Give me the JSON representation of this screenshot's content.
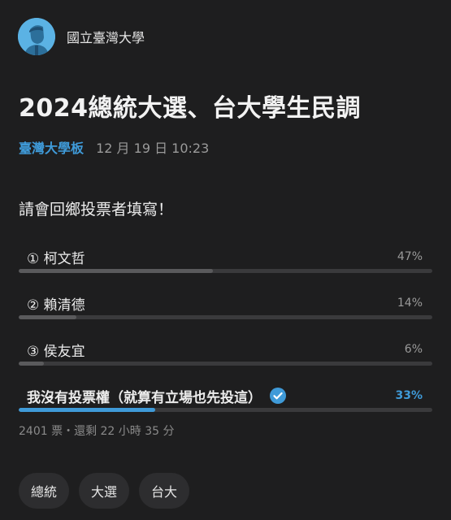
{
  "author": {
    "name": "國立臺灣大學"
  },
  "post": {
    "title": "2024總統大選、台大學生民調",
    "board": "臺灣大學板",
    "date": "12 月 19 日 10:23",
    "body": "請會回鄉投票者填寫！"
  },
  "poll": {
    "options": [
      {
        "label": "① 柯文哲",
        "percent_text": "47%",
        "percent": 47,
        "selected": false
      },
      {
        "label": "② 賴清德",
        "percent_text": "14%",
        "percent": 14,
        "selected": false
      },
      {
        "label": "③ 侯友宜",
        "percent_text": "6%",
        "percent": 6,
        "selected": false
      },
      {
        "label": "我沒有投票權（就算有立場也先投這）",
        "percent_text": "33%",
        "percent": 33,
        "selected": true
      }
    ],
    "footer": "2401 票・還剩 22 小時 35 分"
  },
  "tags": [
    "總統",
    "大選",
    "台大"
  ],
  "colors": {
    "background": "#1e1e1f",
    "accent": "#3f9ad8",
    "avatar": "#5bb2e4",
    "bar_track": "#3a3a3c",
    "bar_fill": "#5a5a5c"
  },
  "icons": {
    "avatar": "user-silhouette-icon",
    "selected": "check-circle-icon"
  }
}
